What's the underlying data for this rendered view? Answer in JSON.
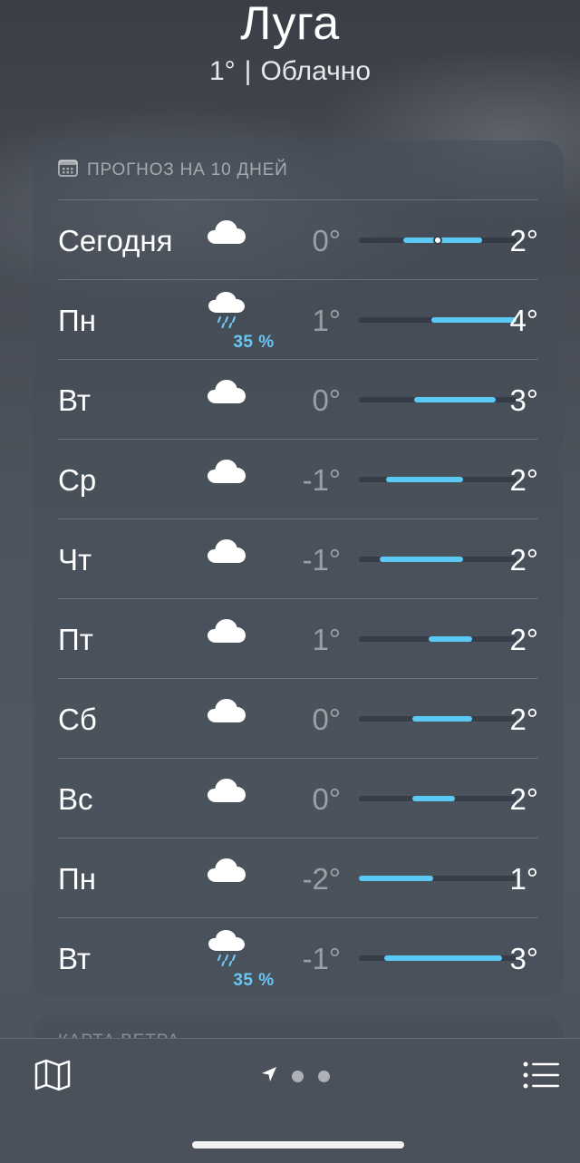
{
  "header": {
    "city": "Луга",
    "temp": "1°",
    "separator": "|",
    "condition": "Облачно"
  },
  "forecast": {
    "title": "ПРОГНОЗ НА 10 ДНЕЙ",
    "days": [
      {
        "day": "Сегодня",
        "icon": "cloud-icon",
        "precip": "",
        "low": "0°",
        "high": "2°",
        "range_start": 0.28,
        "range_end": 0.78,
        "current_marker": 0.5
      },
      {
        "day": "Пн",
        "icon": "cloud-rain-icon",
        "precip": "35 %",
        "low": "1°",
        "high": "4°",
        "range_start": 0.46,
        "range_end": 1.0
      },
      {
        "day": "Вт",
        "icon": "cloud-icon",
        "precip": "",
        "low": "0°",
        "high": "3°",
        "range_start": 0.35,
        "range_end": 0.87
      },
      {
        "day": "Ср",
        "icon": "cloud-icon",
        "precip": "",
        "low": "-1°",
        "high": "2°",
        "range_start": 0.17,
        "range_end": 0.66
      },
      {
        "day": "Чт",
        "icon": "cloud-icon",
        "precip": "",
        "low": "-1°",
        "high": "2°",
        "range_start": 0.13,
        "range_end": 0.66
      },
      {
        "day": "Пт",
        "icon": "cloud-icon",
        "precip": "",
        "low": "1°",
        "high": "2°",
        "range_start": 0.44,
        "range_end": 0.72
      },
      {
        "day": "Сб",
        "icon": "cloud-icon",
        "precip": "",
        "low": "0°",
        "high": "2°",
        "range_start": 0.34,
        "range_end": 0.72
      },
      {
        "day": "Вс",
        "icon": "cloud-icon",
        "precip": "",
        "low": "0°",
        "high": "2°",
        "range_start": 0.34,
        "range_end": 0.61
      },
      {
        "day": "Пн",
        "icon": "cloud-icon",
        "precip": "",
        "low": "-2°",
        "high": "1°",
        "range_start": 0.0,
        "range_end": 0.47
      },
      {
        "day": "Вт",
        "icon": "cloud-rain-icon",
        "precip": "35 %",
        "low": "-1°",
        "high": "3°",
        "range_start": 0.16,
        "range_end": 0.91
      }
    ]
  },
  "next_section": {
    "title": "КАРТА ВЕТРА"
  },
  "toolbar": {
    "map": "map-icon",
    "location": "location-arrow-icon",
    "list": "list-icon",
    "page_count": 3
  },
  "colors": {
    "accent": "#5cc8f4",
    "precip": "#6ac6f5"
  }
}
